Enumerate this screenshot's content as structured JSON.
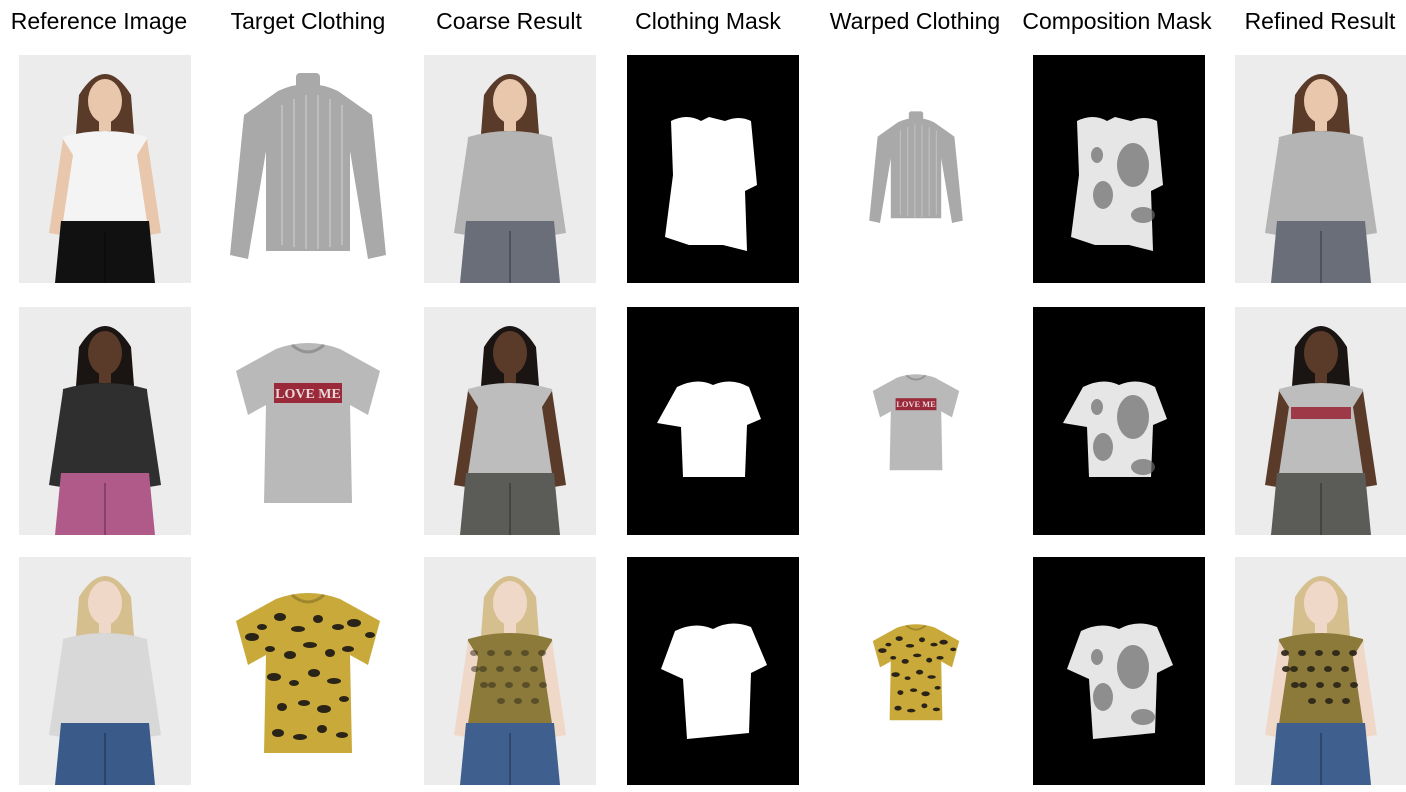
{
  "headers": [
    "Reference Image",
    "Target Clothing",
    "Coarse Result",
    "Clothing Mask",
    "Warped Clothing",
    "Composition Mask",
    "Refined Result"
  ],
  "garment_print_text": "LOVE ME",
  "rows": [
    {
      "reference": {
        "skin": "#e8c7ad",
        "hair": "#5a3a28",
        "top": "#f4f4f4",
        "bottom": "#111111"
      },
      "target": {
        "kind": "longsleeve",
        "color": "#a9a9a9"
      },
      "result": {
        "skin": "#e8c7ad",
        "hair": "#5a3a28",
        "top": "#b4b4b4",
        "bottom": "#6a6e78"
      }
    },
    {
      "reference": {
        "skin": "#5a3b2a",
        "hair": "#1a1412",
        "top": "#2f2f2f",
        "bottom": "#b05a8a"
      },
      "target": {
        "kind": "tshirt-print",
        "color": "#b9b9b9"
      },
      "result": {
        "skin": "#5a3b2a",
        "hair": "#1a1412",
        "top": "#bdbdbd",
        "bottom": "#5b5b58"
      }
    },
    {
      "reference": {
        "skin": "#f0d8c8",
        "hair": "#d6bf8e",
        "top": "#d8d8d8",
        "bottom": "#3a5a8a"
      },
      "target": {
        "kind": "tshirt-leopard",
        "color": "#c9a93a"
      },
      "result": {
        "skin": "#f0d8c8",
        "hair": "#d6bf8e",
        "top": "#8b7a3a",
        "bottom": "#3f5f8e"
      }
    }
  ]
}
